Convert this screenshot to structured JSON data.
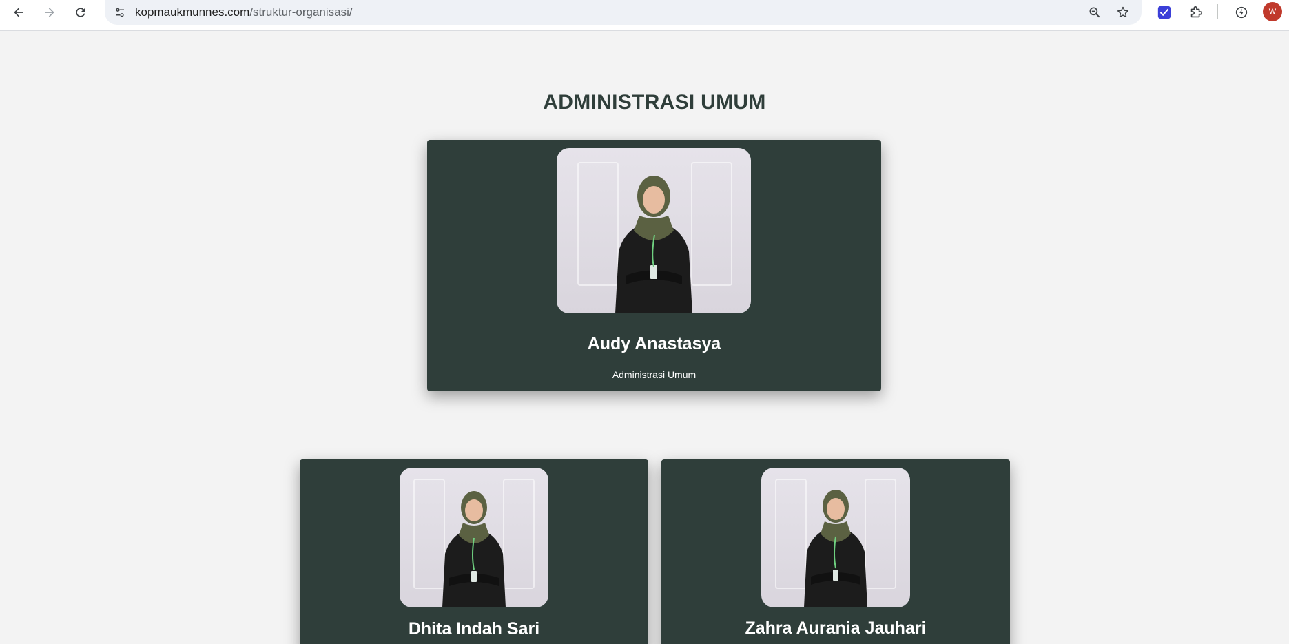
{
  "browser": {
    "url_domain": "kopmaukmunnes.com",
    "url_path": "/struktur-organisasi/",
    "profile_initial": "W",
    "icons": {
      "back": "back-arrow-icon",
      "forward": "forward-arrow-icon",
      "reload": "reload-icon",
      "site_info": "tune-icon",
      "zoom": "zoom-icon",
      "bookmark": "star-icon",
      "extension_1": "check-extension-icon",
      "extensions": "puzzle-icon",
      "performance": "speed-icon"
    }
  },
  "section": {
    "title": "ADMINISTRASI UMUM"
  },
  "members": [
    {
      "name": "Audy Anastasya",
      "role": "Administrasi Umum"
    },
    {
      "name": "Dhita Indah Sari"
    },
    {
      "name": "Zahra Aurania Jauhari"
    }
  ],
  "colors": {
    "card_bg": "#2f3e3a",
    "page_bg": "#f3f3f3",
    "title": "#2f3e3a"
  }
}
